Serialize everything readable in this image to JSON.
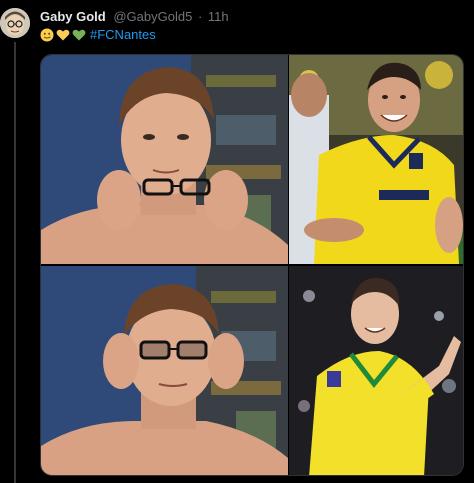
{
  "tweet": {
    "display_name": "Gaby Gold",
    "handle": "@GabyGold5",
    "separator": "·",
    "time": "11h",
    "emojis": [
      "smiling-face-with-tear-emoji",
      "yellow-heart-emoji",
      "green-heart-emoji"
    ],
    "hashtag": "#FCNantes"
  },
  "colors": {
    "background": "#000000",
    "text_primary": "#e7e9ea",
    "text_secondary": "#71767b",
    "link": "#1d9bf0",
    "thread_line": "#333639",
    "jersey_yellow": "#f2d81a",
    "jersey_green": "#1f8a3b"
  },
  "media": {
    "panels": [
      "meme-panel-glasses-removed",
      "meme-panel-player-smiling",
      "meme-panel-glasses-on",
      "meme-panel-player-celebrating"
    ]
  }
}
